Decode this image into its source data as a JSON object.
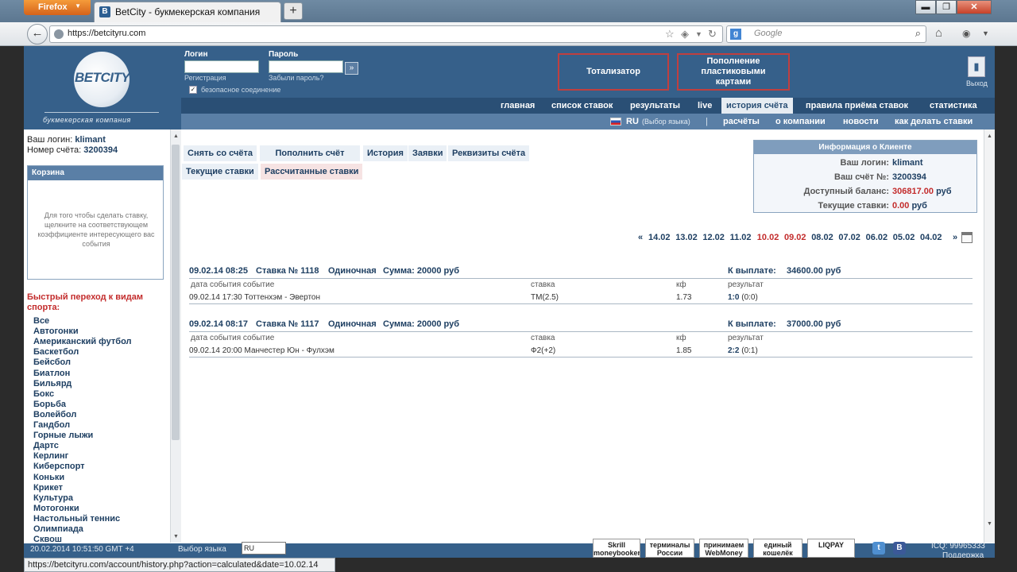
{
  "browser": {
    "app_button": "Firefox",
    "tab_title": "BetCity - букмекерская компания",
    "url": "https://betcityru.com",
    "search_placeholder": "Google",
    "status_url": "https://betcityru.com/account/history.php?action=calculated&date=10.02.14"
  },
  "header": {
    "logo_text": "BETCITY",
    "logo_sub": "букмекерская компания",
    "login_label": "Логин",
    "password_label": "Пароль",
    "register_link": "Регистрация",
    "forgot_link": "Забыли пароль?",
    "secure_label": "безопасное соединение",
    "totalizator": "Тотализатор",
    "topup": "Пополнение пластиковыми картами",
    "exit_label": "Выход"
  },
  "menu1": [
    "главная",
    "список ставок",
    "результаты",
    "live",
    "история счёта",
    "правила приёма ставок",
    "статистика"
  ],
  "menu2": {
    "lang": "RU",
    "lang_hint": "(Выбор языка)",
    "items": [
      "расчёты",
      "о компании",
      "новости",
      "как делать ставки"
    ]
  },
  "sidebar": {
    "login_label": "Ваш логин:",
    "login_value": "klimant",
    "account_label": "Номер счёта:",
    "account_value": "3200394",
    "cart_title": "Корзина",
    "cart_text": "Для того чтобы сделать ставку, щелкните на соответствующем коэффициенте интересующего вас события",
    "quick_title": "Быстрый переход к видам спорта:",
    "sports": [
      "Все",
      "Автогонки",
      "Американский футбол",
      "Баскетбол",
      "Бейсбол",
      "Биатлон",
      "Бильярд",
      "Бокс",
      "Борьба",
      "Волейбол",
      "Гандбол",
      "Горные лыжи",
      "Дартс",
      "Керлинг",
      "Киберспорт",
      "Коньки",
      "Крикет",
      "Культура",
      "Мотогонки",
      "Настольный теннис",
      "Олимпиада",
      "Сквош"
    ]
  },
  "subtabs": {
    "withdraw": "Снять со счёта",
    "deposit": "Пополнить счёт",
    "history": "История",
    "requests": "Заявки",
    "details": "Реквизиты счёта",
    "current": "Текущие ставки",
    "calculated": "Рассчитанные ставки"
  },
  "client": {
    "title": "Информация о Клиенте",
    "login_label": "Ваш логин:",
    "login_value": "klimant",
    "account_label": "Ваш счёт №:",
    "account_value": "3200394",
    "balance_label": "Доступный баланс:",
    "balance_value": "306817.00",
    "balance_unit": "руб",
    "current_label": "Текущие ставки:",
    "current_value": "0.00",
    "current_unit": "руб"
  },
  "dates": {
    "prev": "«",
    "next": "»",
    "items": [
      "14.02",
      "13.02",
      "12.02",
      "11.02",
      "10.02",
      "09.02",
      "08.02",
      "07.02",
      "06.02",
      "05.02",
      "04.02"
    ]
  },
  "columns": {
    "date_event": "дата события событие",
    "stake": "ставка",
    "kf": "кф",
    "result": "результат"
  },
  "bets": [
    {
      "datetime": "09.02.14 08:25",
      "number": "Ставка № 1118",
      "type": "Одиночная",
      "sum": "Сумма: 20000 руб",
      "payout_label": "К выплате:",
      "payout": "34600.00 руб",
      "event": "09.02.14 17:30 Тоттенхэм - Эвертон",
      "stake": "ТМ(2.5)",
      "kf": "1.73",
      "score": "1:0",
      "halftime": "(0:0)"
    },
    {
      "datetime": "09.02.14 08:17",
      "number": "Ставка № 1117",
      "type": "Одиночная",
      "sum": "Сумма: 20000 руб",
      "payout_label": "К выплате:",
      "payout": "37000.00 руб",
      "event": "09.02.14 20:00 Манчестер Юн - Фулхэм",
      "stake": "Ф2(+2)",
      "kf": "1.85",
      "score": "2:2",
      "halftime": "(0:1)"
    }
  ],
  "footer": {
    "datetime": "20.02.2014 10:51:50 GMT +4",
    "lang_label": "Выбор языка",
    "lang_value": "RU",
    "payments": [
      "Skrill moneybookers",
      "терминалы России",
      "принимаем WebMoney",
      "единый кошелёк",
      "LIQPAY"
    ],
    "icq": "ICQ: 99965333",
    "support": "Поддержка"
  }
}
